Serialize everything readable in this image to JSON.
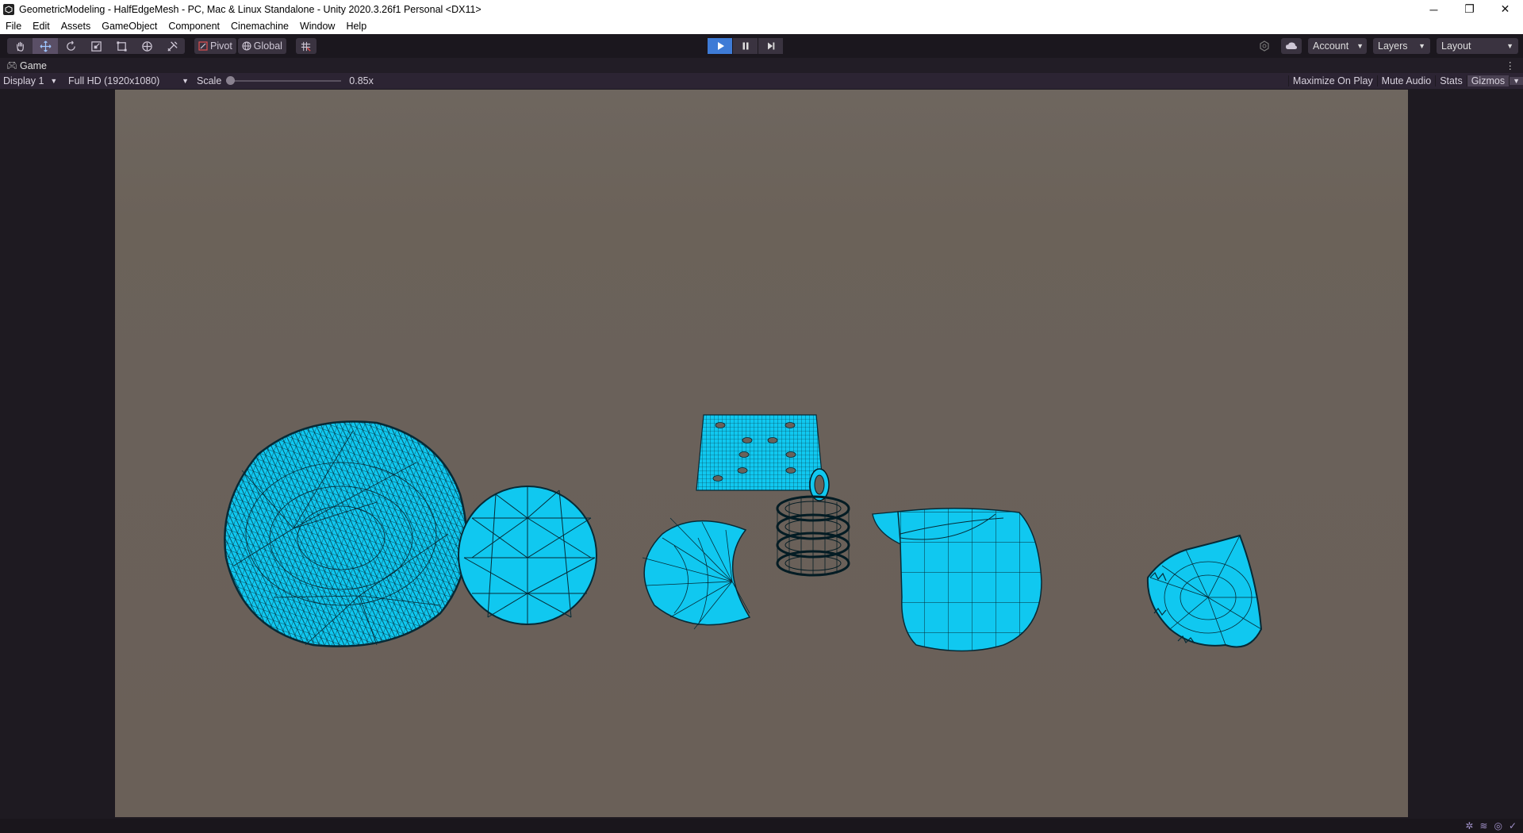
{
  "window": {
    "title": "GeometricModeling - HalfEdgeMesh - PC, Mac & Linux Standalone - Unity 2020.3.26f1 Personal <DX11>",
    "minimize": "─",
    "restore": "❐",
    "close": "✕"
  },
  "menu": [
    "File",
    "Edit",
    "Assets",
    "GameObject",
    "Component",
    "Cinemachine",
    "Window",
    "Help"
  ],
  "toolbar": {
    "pivot_label": "Pivot",
    "global_label": "Global",
    "account_label": "Account",
    "layers_label": "Layers",
    "layout_label": "Layout"
  },
  "game_tab": {
    "label": "Game",
    "display": "Display 1",
    "resolution": "Full HD (1920x1080)",
    "scale_label": "Scale",
    "scale_value": "0.85x",
    "scale_fraction": 0.0,
    "maximize_on_play": "Maximize On Play",
    "mute_audio": "Mute Audio",
    "stats": "Stats",
    "gizmos": "Gizmos"
  },
  "colors": {
    "mesh_fill": "#10c8f0",
    "mesh_wire": "#06222c",
    "play_active": "#3e7bd6",
    "viewport_bg": "#6a6159"
  },
  "scene_objects": [
    "organic-blob-mesh",
    "icosphere-mesh",
    "crescent-disc-mesh",
    "perforated-plate-mesh",
    "spring-coil-mesh",
    "mug-mesh",
    "spiky-cone-mesh"
  ]
}
